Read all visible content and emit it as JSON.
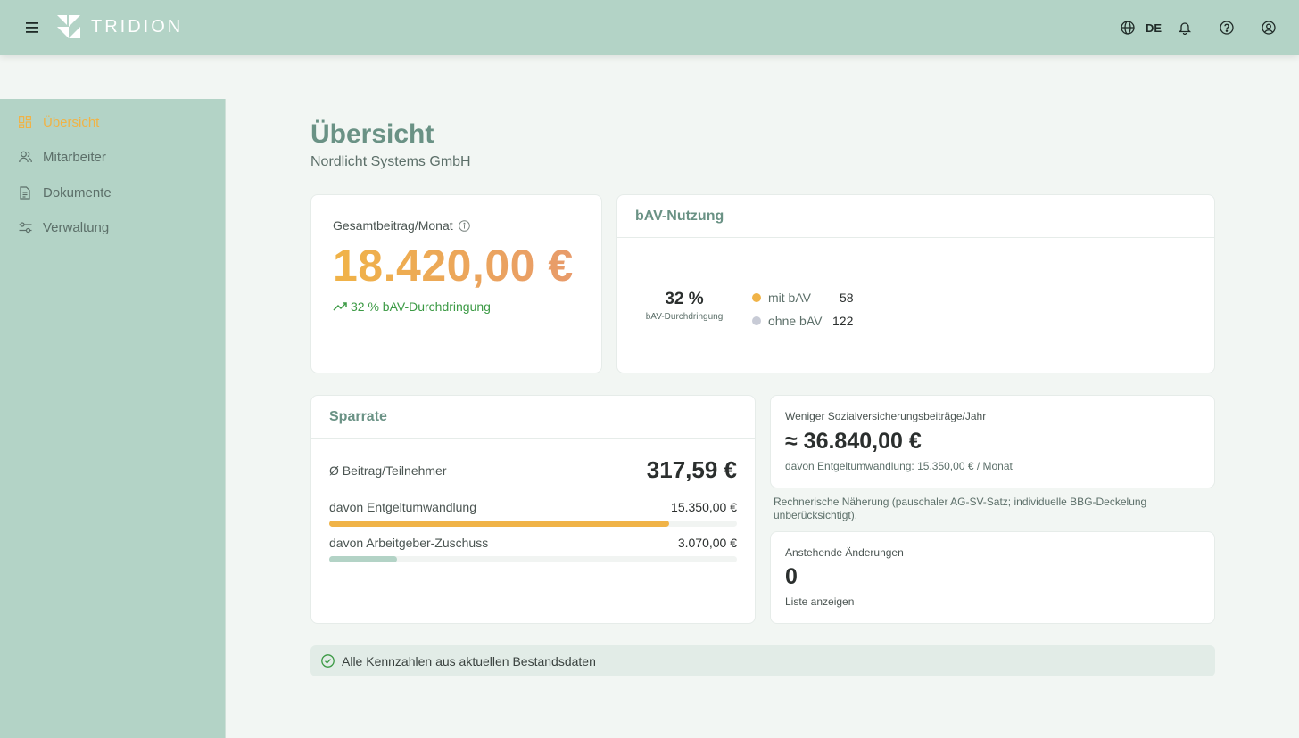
{
  "app": {
    "brand": "TRIDION",
    "language": "DE"
  },
  "colors": {
    "accent": "#f0b347",
    "topbar": "#b3d3c6",
    "heading": "#6a9285",
    "positive": "#3c9a45",
    "muted": "#c8cbd6"
  },
  "sidebar": {
    "items": [
      {
        "label": "Übersicht",
        "icon": "dashboard-icon",
        "active": true
      },
      {
        "label": "Mitarbeiter",
        "icon": "users-icon",
        "active": false
      },
      {
        "label": "Dokumente",
        "icon": "document-icon",
        "active": false
      },
      {
        "label": "Verwaltung",
        "icon": "settings-sliders-icon",
        "active": false
      }
    ]
  },
  "page": {
    "title": "Übersicht",
    "subtitle": "Nordlicht Systems GmbH"
  },
  "total_card": {
    "label": "Gesamtbeitrag/Monat",
    "value": "18.420,00 €",
    "trend": "32 % bAV-Durchdringung"
  },
  "usage_card": {
    "title": "bAV-Nutzung",
    "center_value": "32 %",
    "center_label": "bAV-Durchdringung",
    "legend": [
      {
        "label": "mit bAV",
        "value": "58",
        "color": "#f0b347"
      },
      {
        "label": "ohne bAV",
        "value": "122",
        "color": "#c8cbd6"
      }
    ]
  },
  "savings_card": {
    "title": "Sparrate",
    "avg_label": "Ø Beitrag/Teilnehmer",
    "avg_value": "317,59 €",
    "rows": [
      {
        "label": "davon Entgeltumwandlung",
        "value": "15.350,00 €",
        "fraction": 0.833,
        "color": "#f0b347"
      },
      {
        "label": "davon Arbeitgeber-Zuschuss",
        "value": "3.070,00 €",
        "fraction": 0.167,
        "color": "#b3d3c6"
      }
    ]
  },
  "social_card": {
    "label": "Weniger Sozialversicherungsbeiträge/Jahr",
    "value": "≈ 36.840,00 €",
    "sub": "davon Entgeltumwandlung: 15.350,00 € / Monat",
    "note": "Rechnerische Näherung (pauschaler AG-SV-Satz; individuelle BBG-Deckelung unberücksichtigt)."
  },
  "changes_card": {
    "label": "Anstehende Änderungen",
    "value": "0",
    "link": "Liste anzeigen"
  },
  "status": {
    "text": "Alle Kennzahlen aus aktuellen Bestandsdaten"
  }
}
